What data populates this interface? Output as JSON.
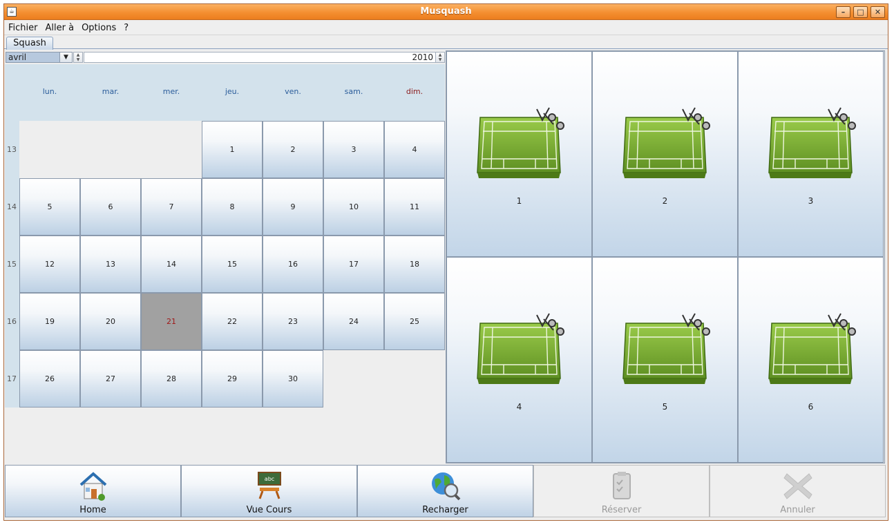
{
  "window": {
    "title": "Musquash",
    "buttons": [
      "minimize",
      "maximize",
      "close"
    ]
  },
  "menu": [
    "Fichier",
    "Aller à",
    "Options",
    "?"
  ],
  "tabs": [
    {
      "label": "Squash",
      "active": true
    }
  ],
  "calendar": {
    "month": "avril",
    "year": "2010",
    "day_names": [
      "lun.",
      "mar.",
      "mer.",
      "jeu.",
      "ven.",
      "sam.",
      "dim."
    ],
    "weeks": [
      {
        "num": "13",
        "days": [
          "",
          "",
          "",
          "1",
          "2",
          "3",
          "4"
        ]
      },
      {
        "num": "14",
        "days": [
          "5",
          "6",
          "7",
          "8",
          "9",
          "10",
          "11"
        ]
      },
      {
        "num": "15",
        "days": [
          "12",
          "13",
          "14",
          "15",
          "16",
          "17",
          "18"
        ]
      },
      {
        "num": "16",
        "days": [
          "19",
          "20",
          "21",
          "22",
          "23",
          "24",
          "25"
        ]
      },
      {
        "num": "17",
        "days": [
          "26",
          "27",
          "28",
          "29",
          "30",
          "",
          ""
        ]
      }
    ],
    "selected_day": "21"
  },
  "courts": [
    "1",
    "2",
    "3",
    "4",
    "5",
    "6"
  ],
  "toolbar": [
    {
      "label": "Home",
      "icon": "home-icon",
      "enabled": true
    },
    {
      "label": "Vue Cours",
      "icon": "classroom-icon",
      "enabled": true
    },
    {
      "label": "Recharger",
      "icon": "globe-search-icon",
      "enabled": true
    },
    {
      "label": "Réserver",
      "icon": "clipboard-icon",
      "enabled": false
    },
    {
      "label": "Annuler",
      "icon": "cross-icon",
      "enabled": false
    }
  ],
  "colors": {
    "titlebar": "#f48f31",
    "accent_blue": "#2a5c9a",
    "sunday": "#8b1a1a",
    "selected_day_bg": "#a1a1a1",
    "court_green": "#6fa22d"
  }
}
